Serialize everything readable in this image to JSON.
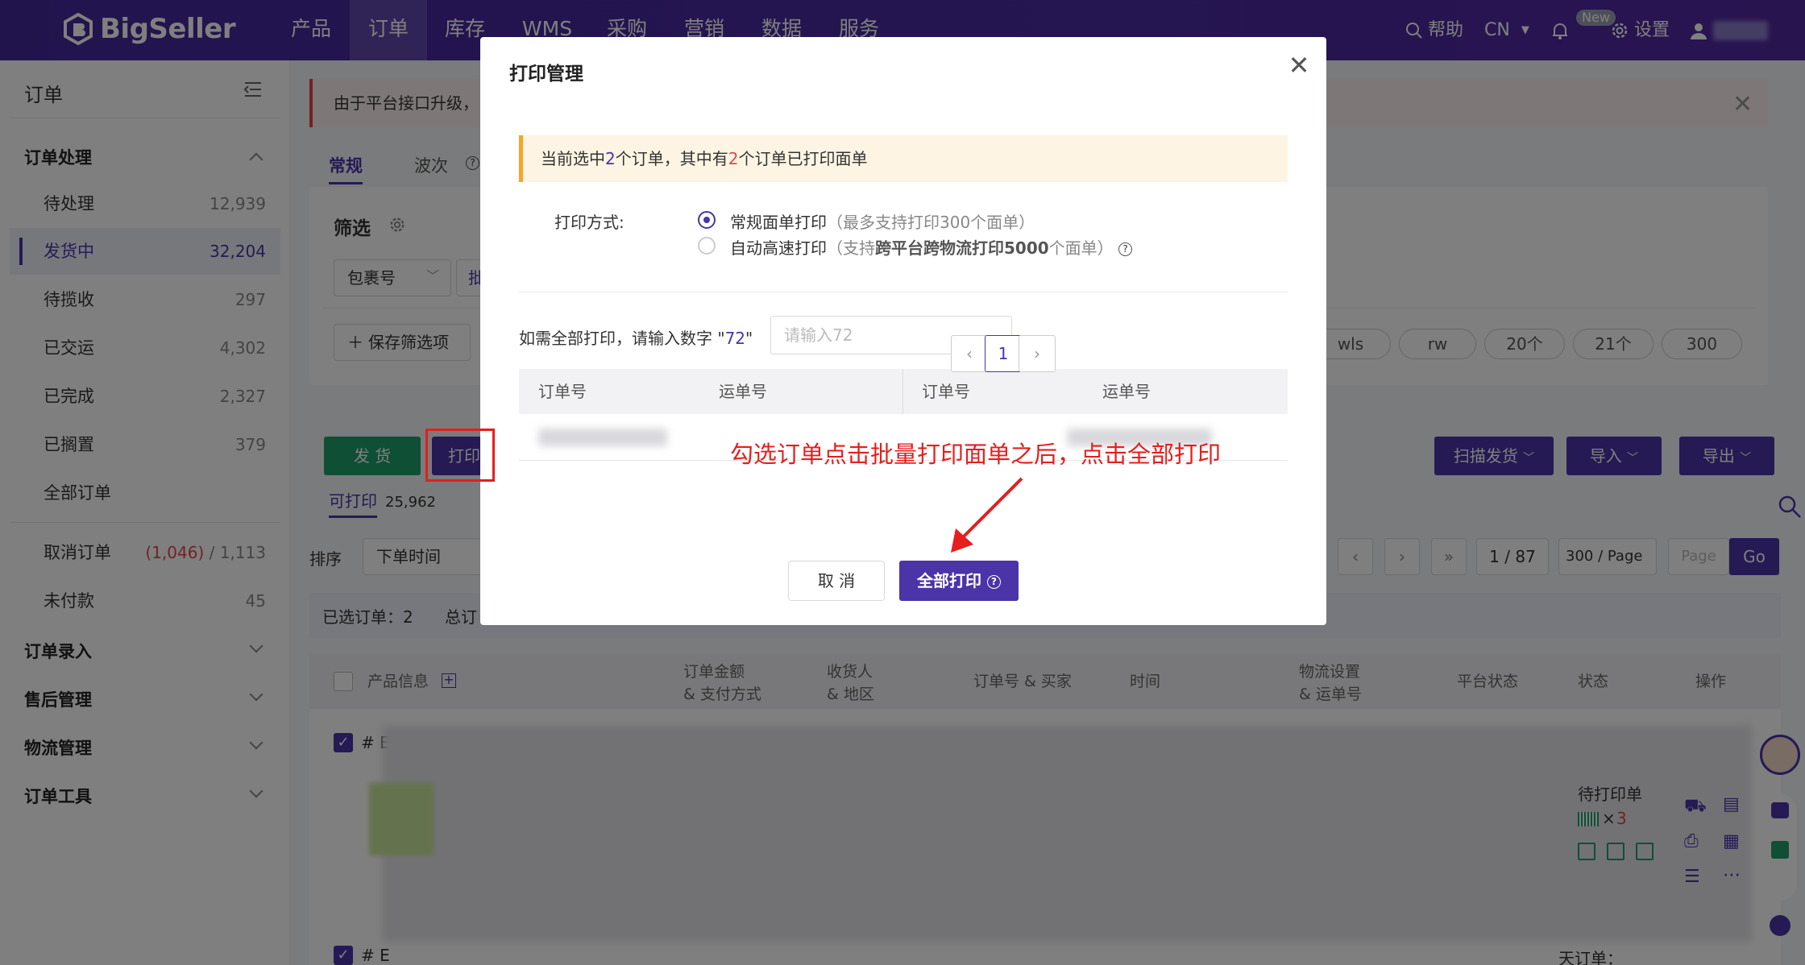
{
  "topnav": {
    "logo": "BigSeller",
    "items": [
      "产品",
      "订单",
      "库存",
      "WMS",
      "采购",
      "营销",
      "数据",
      "服务"
    ],
    "help": "帮助",
    "lang": "CN",
    "new_badge": "New",
    "settings": "设置"
  },
  "sidebar": {
    "title": "订单",
    "group_process": "订单处理",
    "items": [
      {
        "label": "待处理",
        "count": "12,939"
      },
      {
        "label": "发货中",
        "count": "32,204"
      },
      {
        "label": "待揽收",
        "count": "297"
      },
      {
        "label": "已交运",
        "count": "4,302"
      },
      {
        "label": "已完成",
        "count": "2,327"
      },
      {
        "label": "已搁置",
        "count": "379"
      },
      {
        "label": "全部订单",
        "count": ""
      }
    ],
    "cancel": {
      "label": "取消订单",
      "count_red": "(1,046)",
      "count": " / 1,113"
    },
    "unpaid": {
      "label": "未付款",
      "count": "45"
    },
    "groups": [
      "订单录入",
      "售后管理",
      "物流管理",
      "订单工具"
    ]
  },
  "main": {
    "alert": "由于平台接口升级，",
    "tabs": [
      "常规",
      "波次"
    ],
    "filter_title": "筛选",
    "package_select": "包裹号",
    "batch_label": "批",
    "save_filter": "保存筛选项",
    "pills": [
      "wls",
      "rw",
      "20个",
      "21个",
      "300"
    ],
    "ship_btn": "发 货",
    "print_btn": "打印",
    "printable_label": "可打印",
    "printable_count": "25,962",
    "scan_btn": "扫描发货",
    "import_btn": "导入",
    "export_btn": "导出",
    "sort_label": "排序",
    "sort_value": "下单时间",
    "page_info": "1 / 87",
    "page_size": "300 / Page",
    "page_input_placeholder": "Page",
    "go": "Go",
    "selected": "已选订单：2",
    "total": "总订",
    "columns": [
      "产品信息",
      "订单金额\n& 支付方式",
      "收货人\n& 地区",
      "订单号 & 买家",
      "时间",
      "物流设置\n& 运单号",
      "平台状态",
      "状态",
      "操作"
    ],
    "row_prefix": "# E",
    "row_status": "待打印单",
    "row_qty_x": "×",
    "row_qty": "3",
    "row_tail": "天订单："
  },
  "modal": {
    "title": "打印管理",
    "notice": {
      "a": "当前选中",
      "b": "2",
      "c": "个订单，其中有",
      "d": "2",
      "e": "个订单已打印面单"
    },
    "method_label": "打印方式:",
    "opt1": "常规面单打印",
    "opt1_note": "（最多支持打印300个面单）",
    "opt2": "自动高速打印",
    "opt2_note_a": "（支持",
    "opt2_note_b": "跨平台跨物流打印5000",
    "opt2_note_c": "个面单）",
    "confirm_a": "如需全部打印，请输入数字 \"",
    "confirm_num": "72",
    "confirm_b": "\"",
    "input_placeholder": "请输入72",
    "col_order": "订单号",
    "col_tracking": "运单号",
    "page_current": "1",
    "cancel": "取 消",
    "print_all": "全部打印"
  },
  "annotation": "勾选订单点击批量打印面单之后，点击全部打印",
  "colors": {
    "brand": "#4a2aa3",
    "green": "#1e9e6a",
    "red": "#e61e1e",
    "notice": "#f5a623"
  }
}
